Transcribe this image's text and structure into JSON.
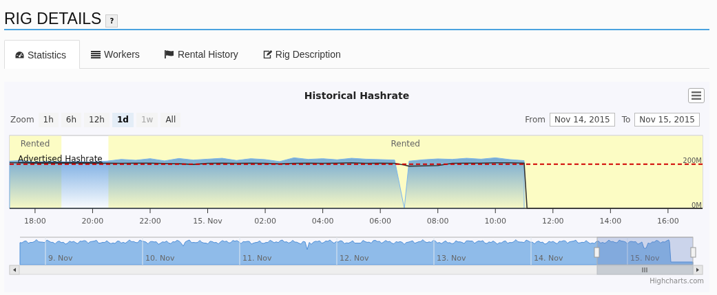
{
  "page": {
    "title": "RIG DETAILS",
    "help_button": "?"
  },
  "tabs": [
    {
      "label": "Statistics",
      "selected": true
    },
    {
      "label": "Workers",
      "selected": false
    },
    {
      "label": "Rental History",
      "selected": false
    },
    {
      "label": "Rig Description",
      "selected": false
    }
  ],
  "chart_panel": {
    "title": "Historical Hashrate",
    "zoom_label": "Zoom",
    "zoom_buttons": [
      {
        "label": "1h",
        "selected": false,
        "disabled": false
      },
      {
        "label": "6h",
        "selected": false,
        "disabled": false
      },
      {
        "label": "12h",
        "selected": false,
        "disabled": false
      },
      {
        "label": "1d",
        "selected": true,
        "disabled": false
      },
      {
        "label": "1w",
        "selected": false,
        "disabled": true
      },
      {
        "label": "All",
        "selected": false,
        "disabled": false
      }
    ],
    "from_label": "From",
    "from_value": "Nov 14, 2015",
    "to_label": "To",
    "to_value": "Nov 15, 2015",
    "chart_data": {
      "type": "area",
      "x": [
        "2015-11-14T17:07:00",
        "2015-11-14T17:30:00",
        "2015-11-14T18:00:00",
        "2015-11-14T18:30:00",
        "2015-11-14T19:00:00",
        "2015-11-14T19:30:00",
        "2015-11-14T20:00:00",
        "2015-11-14T20:30:00",
        "2015-11-14T21:00:00",
        "2015-11-14T21:30:00",
        "2015-11-14T22:00:00",
        "2015-11-14T22:30:00",
        "2015-11-14T23:00:00",
        "2015-11-14T23:30:00",
        "2015-11-15T00:00:00",
        "2015-11-15T00:30:00",
        "2015-11-15T01:00:00",
        "2015-11-15T01:30:00",
        "2015-11-15T02:00:00",
        "2015-11-15T02:30:00",
        "2015-11-15T03:00:00",
        "2015-11-15T03:30:00",
        "2015-11-15T04:00:00",
        "2015-11-15T04:30:00",
        "2015-11-15T05:00:00",
        "2015-11-15T05:30:00",
        "2015-11-15T06:00:00",
        "2015-11-15T06:30:00",
        "2015-11-15T06:50:00",
        "2015-11-15T07:00:00",
        "2015-11-15T07:30:00",
        "2015-11-15T08:00:00",
        "2015-11-15T08:30:00",
        "2015-11-15T09:00:00",
        "2015-11-15T09:30:00",
        "2015-11-15T10:00:00",
        "2015-11-15T10:30:00",
        "2015-11-15T11:00:00",
        "2015-11-15T11:06:00",
        "2015-11-15T17:12:00"
      ],
      "series": [
        {
          "color": "#7cb5ec",
          "values": [
            214,
            216,
            210,
            213,
            211,
            212,
            210,
            214,
            222,
            218,
            225,
            215,
            226,
            219,
            223,
            227,
            217,
            225,
            221,
            212,
            229,
            222,
            225,
            220,
            227,
            223,
            221,
            219,
            0,
            214,
            220,
            224,
            222,
            227,
            223,
            229,
            221,
            216,
            null,
            null
          ]
        },
        {
          "color": "#333333",
          "type": "line",
          "values": [
            207,
            206,
            205,
            205,
            205,
            205,
            204,
            205,
            204,
            205,
            205,
            203,
            202,
            199,
            204,
            205,
            204,
            205,
            204,
            201,
            204,
            205,
            204,
            205,
            206,
            204,
            205,
            204,
            196,
            191,
            192,
            194,
            204,
            205,
            205,
            206,
            206,
            205,
            0,
            0
          ]
        }
      ],
      "xlim": [
        "2015-11-14T17:07:00",
        "2015-11-15T17:12:00"
      ],
      "ylim": [
        0,
        330
      ],
      "xticks": [
        {
          "value": "2015-11-14T18:00:00",
          "label": "18:00"
        },
        {
          "value": "2015-11-14T20:00:00",
          "label": "20:00"
        },
        {
          "value": "2015-11-14T22:00:00",
          "label": "22:00"
        },
        {
          "value": "2015-11-15T00:00:00",
          "label": "15. Nov"
        },
        {
          "value": "2015-11-15T02:00:00",
          "label": "02:00"
        },
        {
          "value": "2015-11-15T04:00:00",
          "label": "04:00"
        },
        {
          "value": "2015-11-15T06:00:00",
          "label": "06:00"
        },
        {
          "value": "2015-11-15T08:00:00",
          "label": "08:00"
        },
        {
          "value": "2015-11-15T10:00:00",
          "label": "10:00"
        },
        {
          "value": "2015-11-15T12:00:00",
          "label": "12:00"
        },
        {
          "value": "2015-11-15T14:00:00",
          "label": "14:00"
        },
        {
          "value": "2015-11-15T16:00:00",
          "label": "16:00"
        }
      ],
      "yticks": [
        {
          "value": 0,
          "label": "0M"
        },
        {
          "value": 200,
          "label": "200M"
        }
      ],
      "bands": [
        {
          "axis": "x",
          "from": "2015-11-14T17:07:00",
          "to": "2015-11-14T18:55:00",
          "label": "Rented"
        },
        {
          "axis": "x",
          "from": "2015-11-14T20:33:00",
          "to": "2015-11-15T17:12:00",
          "label": "Rented"
        }
      ],
      "ref_lines": [
        {
          "axis": "y",
          "value": 200,
          "label": "Advertised Hashrate"
        }
      ]
    },
    "navigator_labels": [
      "9. Nov",
      "10. Nov",
      "11. Nov",
      "12. Nov",
      "13. Nov",
      "14. Nov",
      "15. Nov"
    ],
    "credit": "Highcharts.com"
  }
}
